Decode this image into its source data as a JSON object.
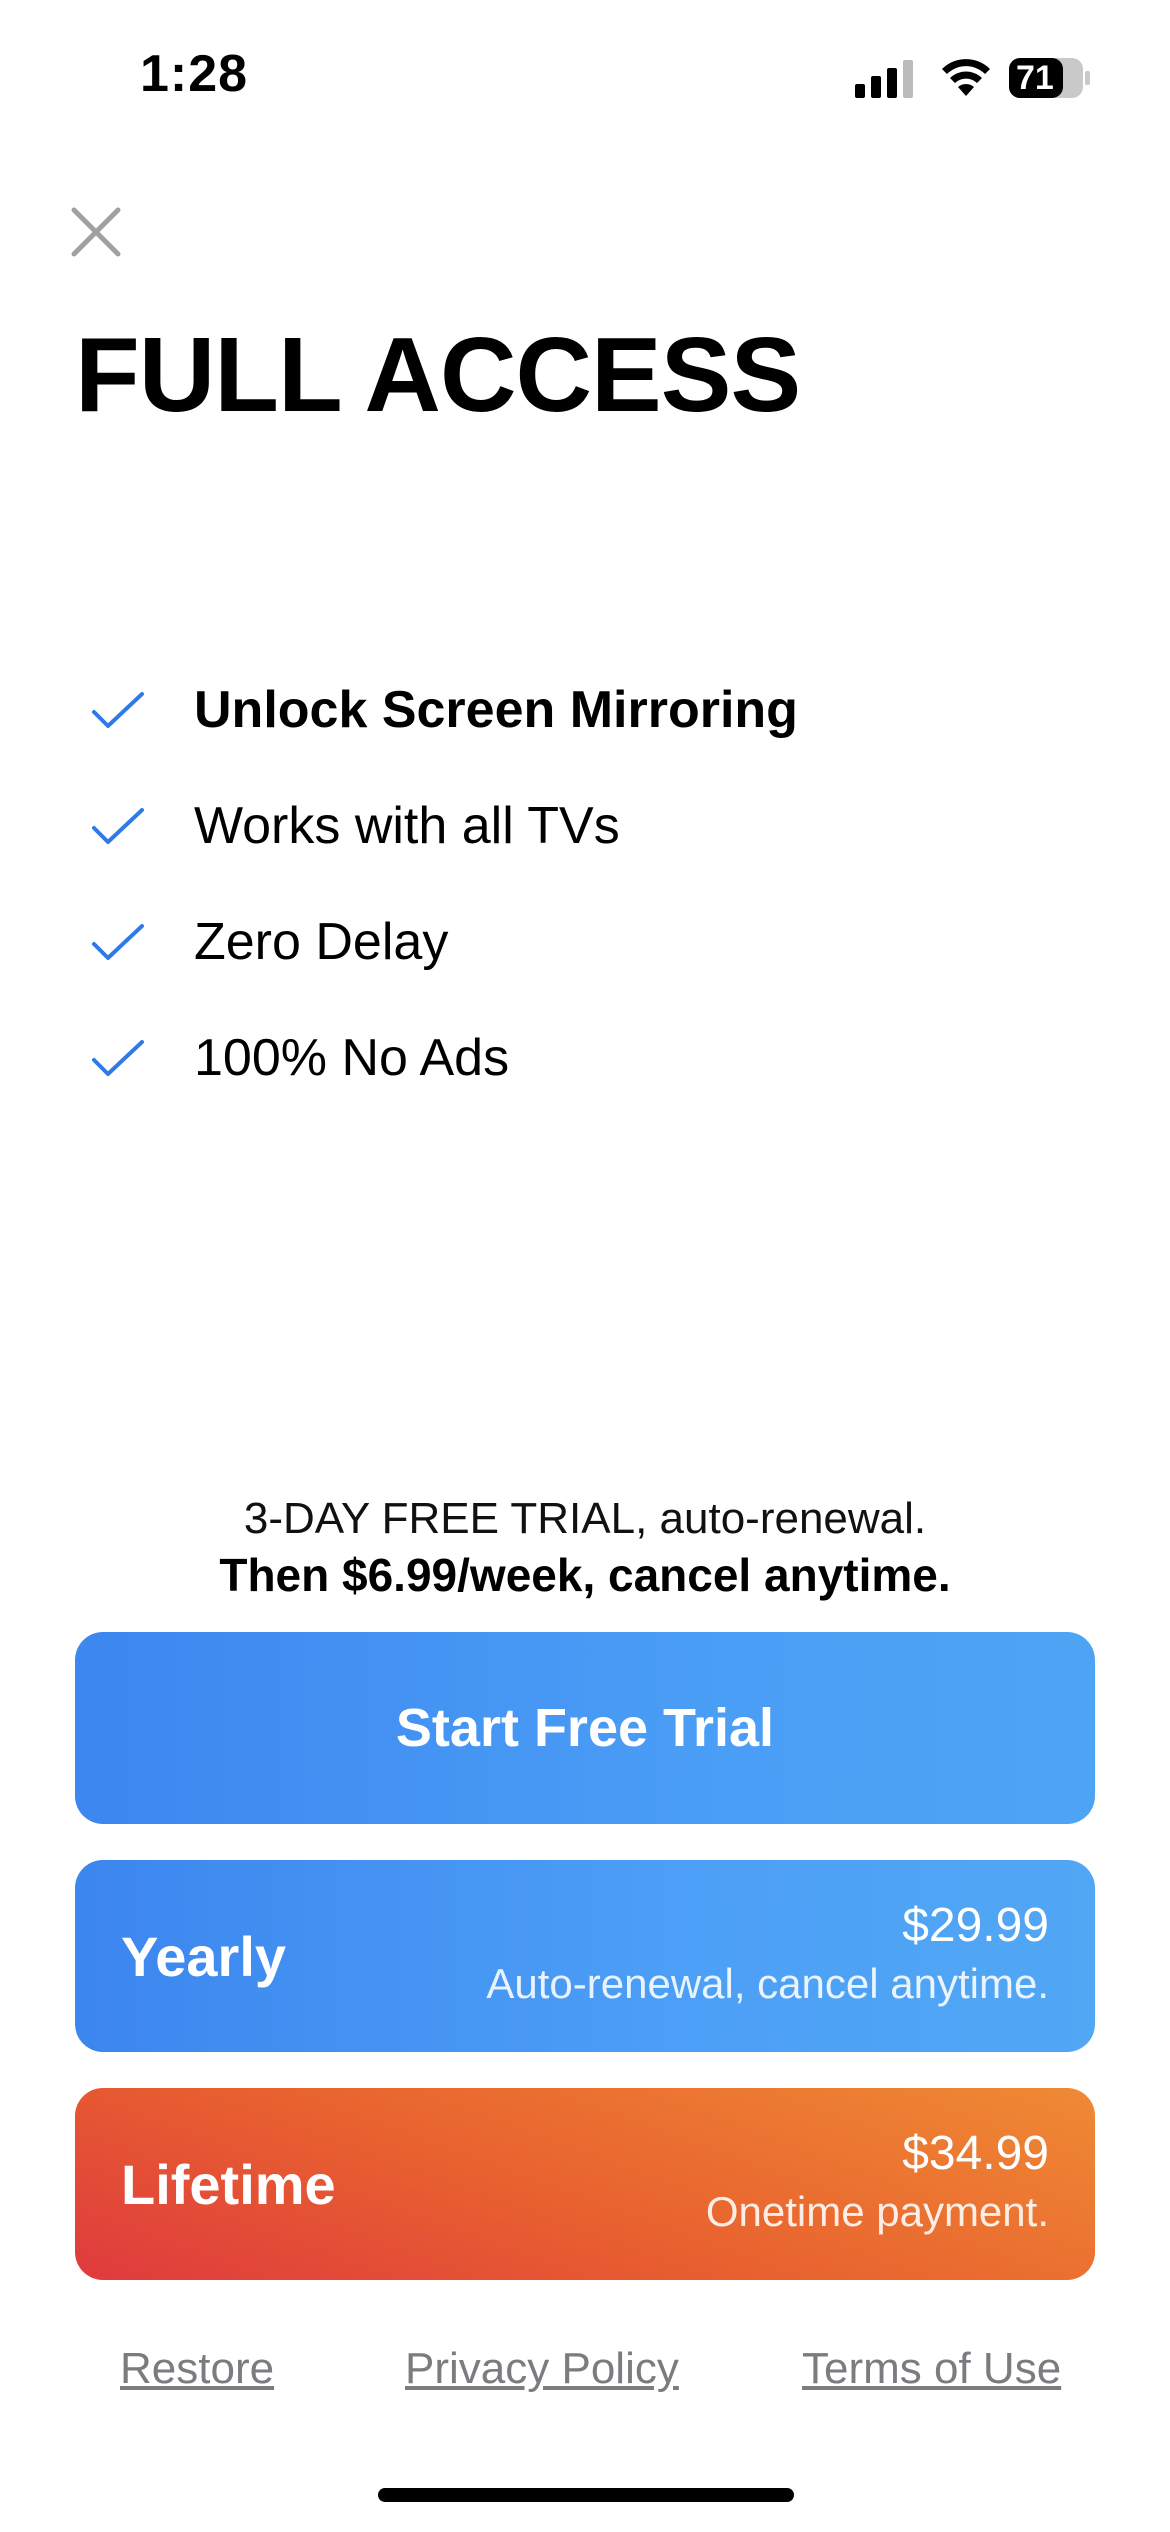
{
  "status_bar": {
    "time": "1:28",
    "battery_level": "71",
    "icons": [
      "signal-icon",
      "wifi-icon",
      "battery-icon"
    ]
  },
  "header": {
    "close_icon": "close-icon",
    "title": "FULL ACCESS"
  },
  "features": [
    {
      "label": "Unlock Screen Mirroring",
      "bold": true,
      "icon": "checkmark-icon"
    },
    {
      "label": "Works with all TVs",
      "bold": false,
      "icon": "checkmark-icon"
    },
    {
      "label": "Zero Delay",
      "bold": false,
      "icon": "checkmark-icon"
    },
    {
      "label": "100% No Ads",
      "bold": false,
      "icon": "checkmark-icon"
    }
  ],
  "trial_info": {
    "line1": "3-DAY FREE TRIAL, auto-renewal.",
    "line2": "Then $6.99/week, cancel anytime."
  },
  "buttons": {
    "start_trial": "Start Free Trial"
  },
  "plans": [
    {
      "name": "Yearly",
      "price": "$29.99",
      "subtitle": "Auto-renewal, cancel anytime."
    },
    {
      "name": "Lifetime",
      "price": "$34.99",
      "subtitle": "Onetime payment."
    }
  ],
  "footer_links": {
    "restore": "Restore",
    "privacy": "Privacy Policy",
    "terms": "Terms of Use"
  },
  "colors": {
    "accent_blue": "#3c87f0",
    "check_blue": "#2f7ae6",
    "lifetime_red": "#df3a3d",
    "lifetime_orange": "#ef8a34",
    "link_gray": "#7b7b80"
  }
}
